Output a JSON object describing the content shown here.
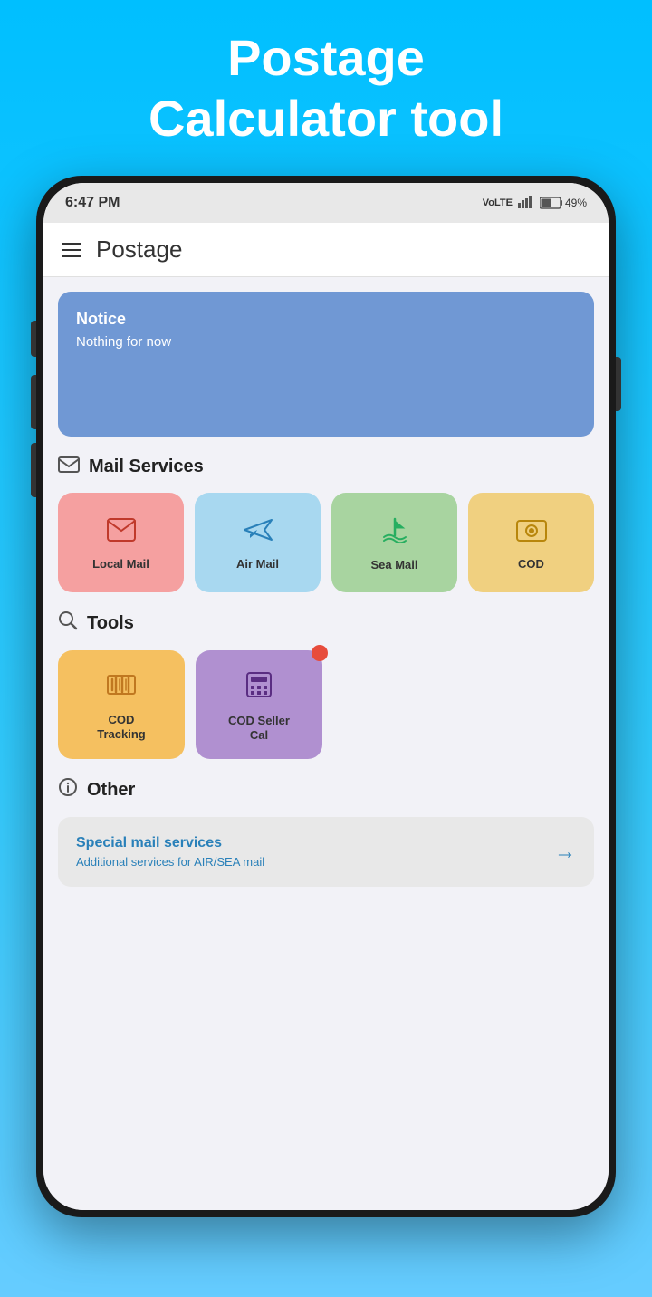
{
  "header": {
    "title": "Postage Calculator tool",
    "line1": "Postage",
    "line2": "Calculator tool"
  },
  "status_bar": {
    "time": "6:47 PM",
    "signal": "▌▌▌▌",
    "battery": "49%",
    "lte": "VoLTE"
  },
  "app_header": {
    "title": "Postage"
  },
  "notice": {
    "title": "Notice",
    "text": "Nothing for now"
  },
  "mail_services": {
    "section_title": "Mail Services",
    "items": [
      {
        "label": "Local Mail",
        "icon": "envelope",
        "color": "pink"
      },
      {
        "label": "Air Mail",
        "icon": "plane",
        "color": "lightblue"
      },
      {
        "label": "Sea Mail",
        "icon": "ship",
        "color": "green"
      },
      {
        "label": "COD",
        "icon": "money",
        "color": "yellow"
      }
    ]
  },
  "tools": {
    "section_title": "Tools",
    "items": [
      {
        "label": "COD\nTracking",
        "label_line1": "COD",
        "label_line2": "Tracking",
        "icon": "barcode",
        "color": "orange",
        "notification": false
      },
      {
        "label": "COD Seller\nCal",
        "label_line1": "COD Seller",
        "label_line2": "Cal",
        "icon": "calculator",
        "color": "purple",
        "notification": true
      }
    ]
  },
  "other": {
    "section_title": "Other",
    "special_mail": {
      "title": "Special mail services",
      "subtitle": "Additional services for AIR/SEA mail"
    }
  }
}
